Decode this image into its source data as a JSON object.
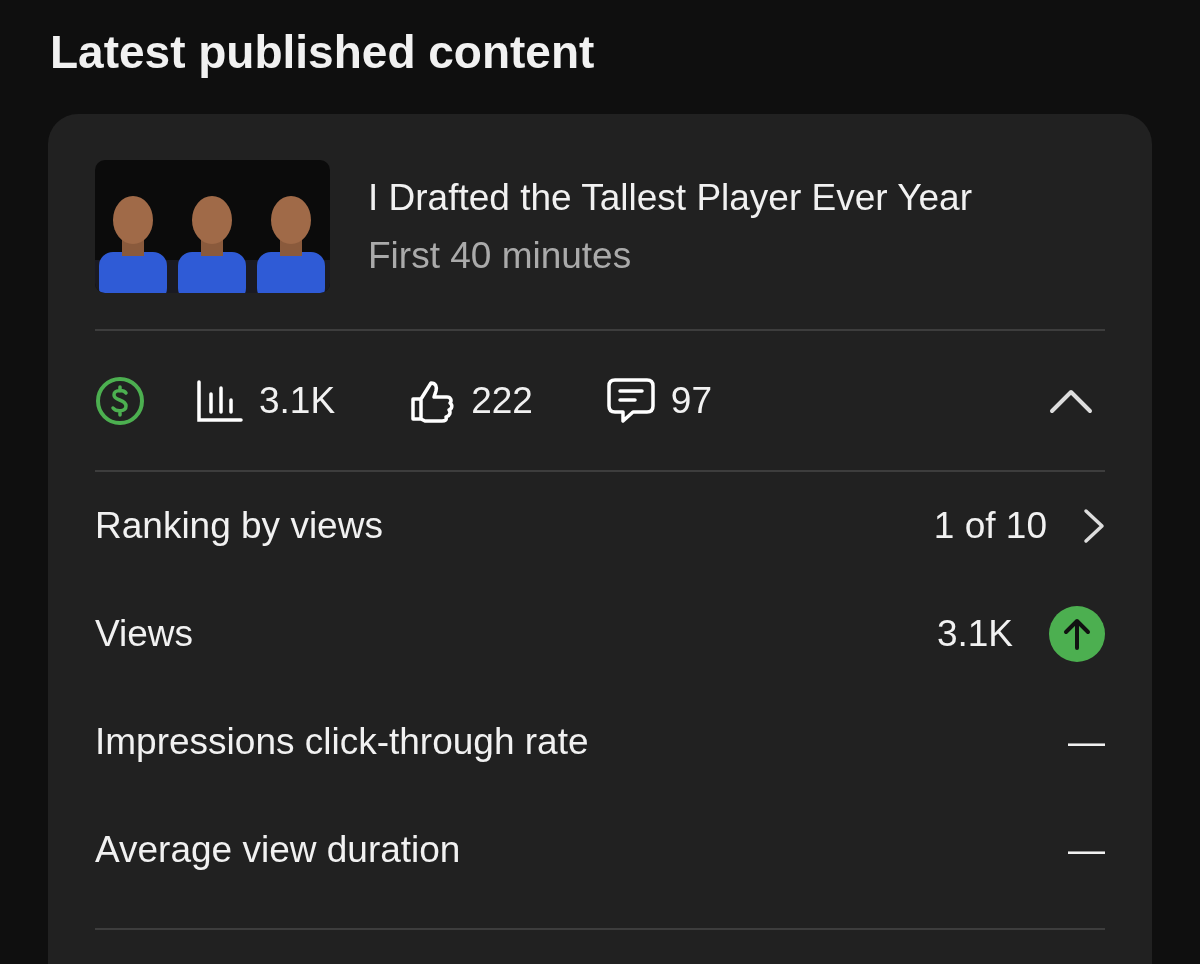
{
  "heading": "Latest published content",
  "video": {
    "title": "I Drafted the Tallest Player Ever Year",
    "subtitle": "First 40 minutes"
  },
  "stats": {
    "expanded": true,
    "items": [
      {
        "kind": "views",
        "value": "3.1K"
      },
      {
        "kind": "likes",
        "value": "222"
      },
      {
        "kind": "comments",
        "value": "97"
      }
    ]
  },
  "metrics": [
    {
      "kind": "link",
      "label": "Ranking by views",
      "value": "1 of 10"
    },
    {
      "kind": "trend",
      "label": "Views",
      "value": "3.1K"
    },
    {
      "kind": "plain",
      "label": "Impressions click-through rate",
      "value": "—"
    },
    {
      "kind": "plain",
      "label": "Average view duration",
      "value": "—"
    }
  ]
}
